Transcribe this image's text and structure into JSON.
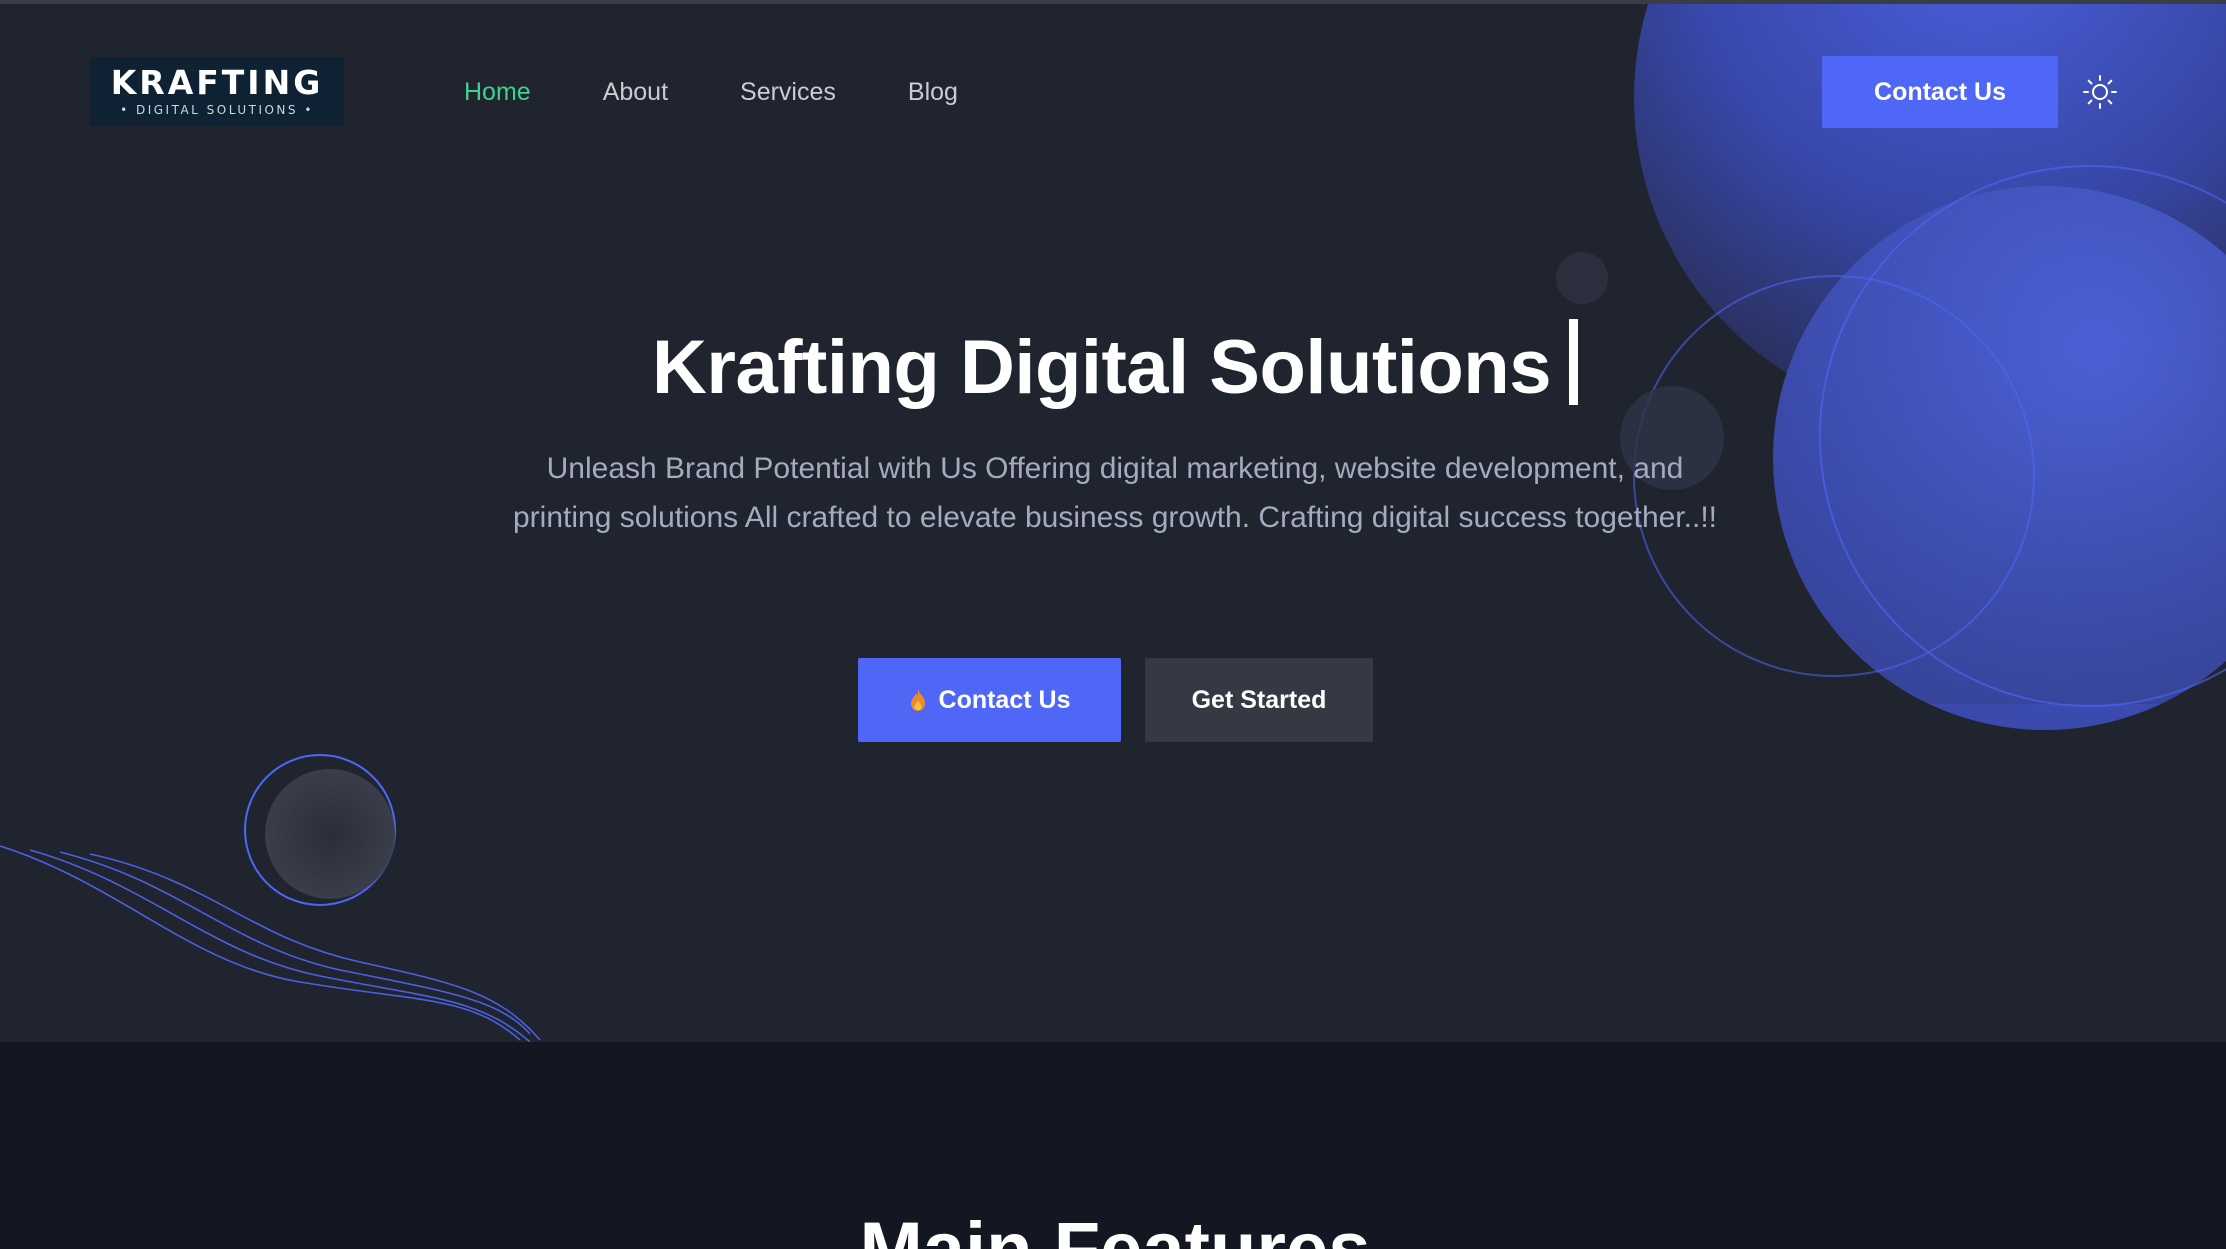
{
  "header": {
    "logo": {
      "word": "KRAFTING",
      "sub": "• DIGITAL SOLUTIONS •"
    },
    "nav": [
      {
        "label": "Home",
        "active": true
      },
      {
        "label": "About",
        "active": false
      },
      {
        "label": "Services",
        "active": false
      },
      {
        "label": "Blog",
        "active": false
      }
    ],
    "contact_label": "Contact Us",
    "theme_icon": "sun-icon"
  },
  "hero": {
    "title": "Krafting Digital Solutions",
    "subtitle": "Unleash Brand Potential with Us Offering digital marketing, website development, and printing solutions All crafted to elevate business growth. Crafting digital success together..!!",
    "primary_button": {
      "label": "Contact Us",
      "icon": "flame-icon"
    },
    "secondary_button": {
      "label": "Get Started"
    }
  },
  "features": {
    "title": "Main Features"
  },
  "colors": {
    "accent": "#4f67f6",
    "nav_active": "#3fd28c",
    "hero_bg": "#20242f",
    "section_bg": "#131722"
  }
}
